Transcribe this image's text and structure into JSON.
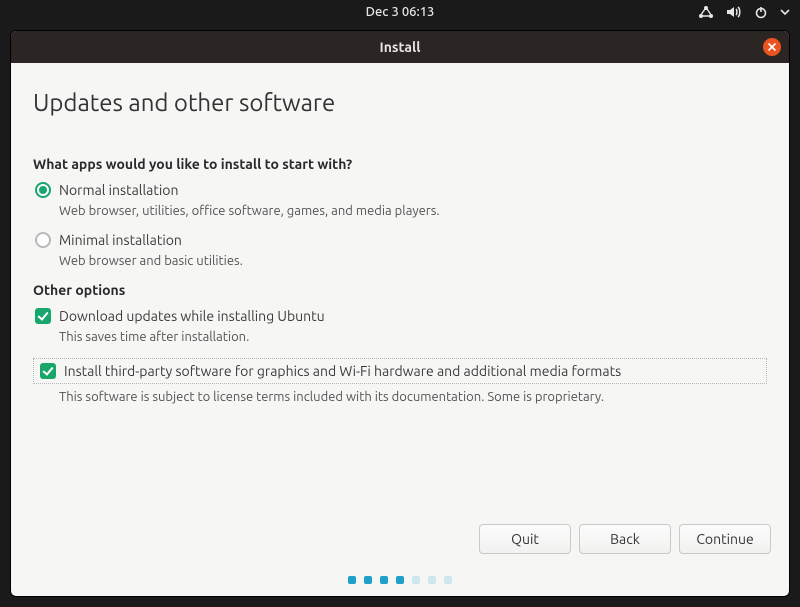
{
  "sysbar": {
    "datetime": "Dec 3  06:13"
  },
  "window": {
    "title": "Install"
  },
  "page": {
    "title": "Updates and other software",
    "question": "What apps would you like to install to start with?",
    "radios": {
      "normal": {
        "label": "Normal installation",
        "desc": "Web browser, utilities, office software, games, and media players."
      },
      "minimal": {
        "label": "Minimal installation",
        "desc": "Web browser and basic utilities."
      }
    },
    "other_options_label": "Other options",
    "checkboxes": {
      "download": {
        "label": "Download updates while installing Ubuntu",
        "desc": "This saves time after installation."
      },
      "thirdparty": {
        "label": "Install third-party software for graphics and Wi-Fi hardware and additional media formats",
        "desc": "This software is subject to license terms included with its documentation. Some is proprietary."
      }
    },
    "buttons": {
      "quit": "Quit",
      "back": "Back",
      "continue": "Continue"
    }
  }
}
